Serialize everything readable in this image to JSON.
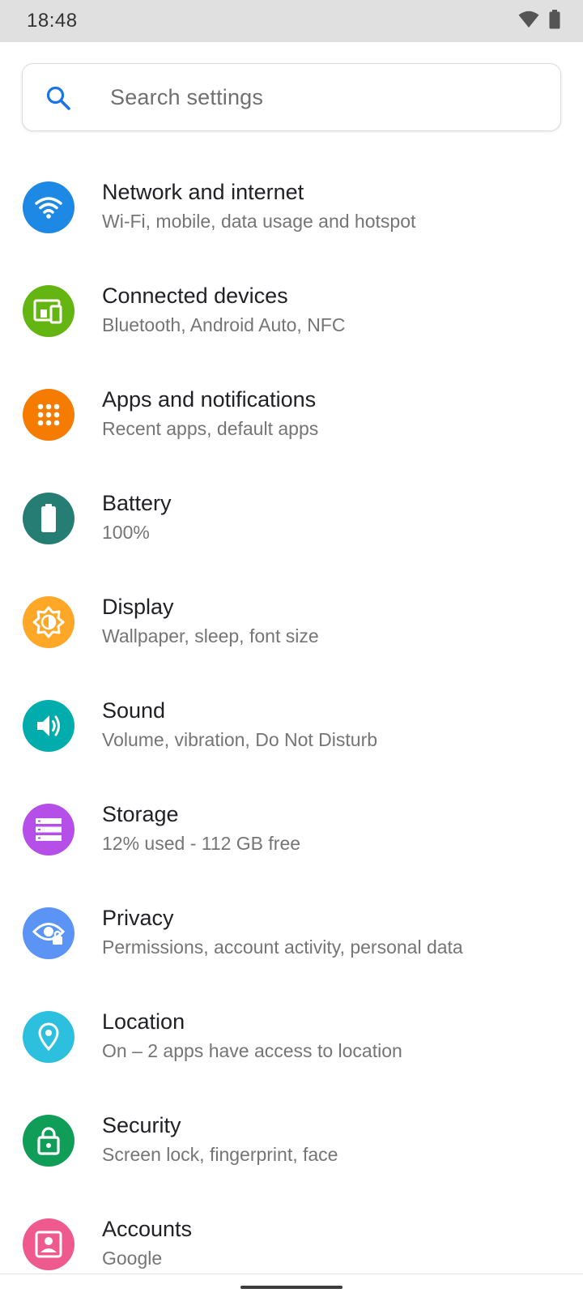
{
  "status_bar": {
    "time": "18:48",
    "icons": [
      "wifi-icon",
      "battery-icon"
    ]
  },
  "search": {
    "placeholder": "Search settings",
    "icon": "search-icon",
    "accent": "#1a73e8"
  },
  "settings": [
    {
      "title": "Network and internet",
      "subtitle": "Wi-Fi, mobile, data usage and hotspot",
      "icon": "wifi-icon",
      "color": "#1e88e5"
    },
    {
      "title": "Connected devices",
      "subtitle": "Bluetooth, Android Auto, NFC",
      "icon": "devices-icon",
      "color": "#64b512"
    },
    {
      "title": "Apps and notifications",
      "subtitle": "Recent apps, default apps",
      "icon": "apps-icon",
      "color": "#f57c00"
    },
    {
      "title": "Battery",
      "subtitle": "100%",
      "icon": "battery-icon",
      "color": "#267d73"
    },
    {
      "title": "Display",
      "subtitle": "Wallpaper, sleep, font size",
      "icon": "brightness-icon",
      "color": "#ffa726"
    },
    {
      "title": "Sound",
      "subtitle": "Volume, vibration, Do Not Disturb",
      "icon": "volume-icon",
      "color": "#00acac"
    },
    {
      "title": "Storage",
      "subtitle": "12% used - 112 GB free",
      "icon": "storage-icon",
      "color": "#b64fe8"
    },
    {
      "title": "Privacy",
      "subtitle": "Permissions, account activity, personal data",
      "icon": "privacy-eye-icon",
      "color": "#5b94f4"
    },
    {
      "title": "Location",
      "subtitle": "On – 2 apps have access to location",
      "icon": "location-pin-icon",
      "color": "#2cc0de"
    },
    {
      "title": "Security",
      "subtitle": "Screen lock, fingerprint, face",
      "icon": "lock-icon",
      "color": "#0f9d58"
    },
    {
      "title": "Accounts",
      "subtitle": "Google",
      "icon": "account-icon",
      "color": "#ef5a8e"
    }
  ]
}
